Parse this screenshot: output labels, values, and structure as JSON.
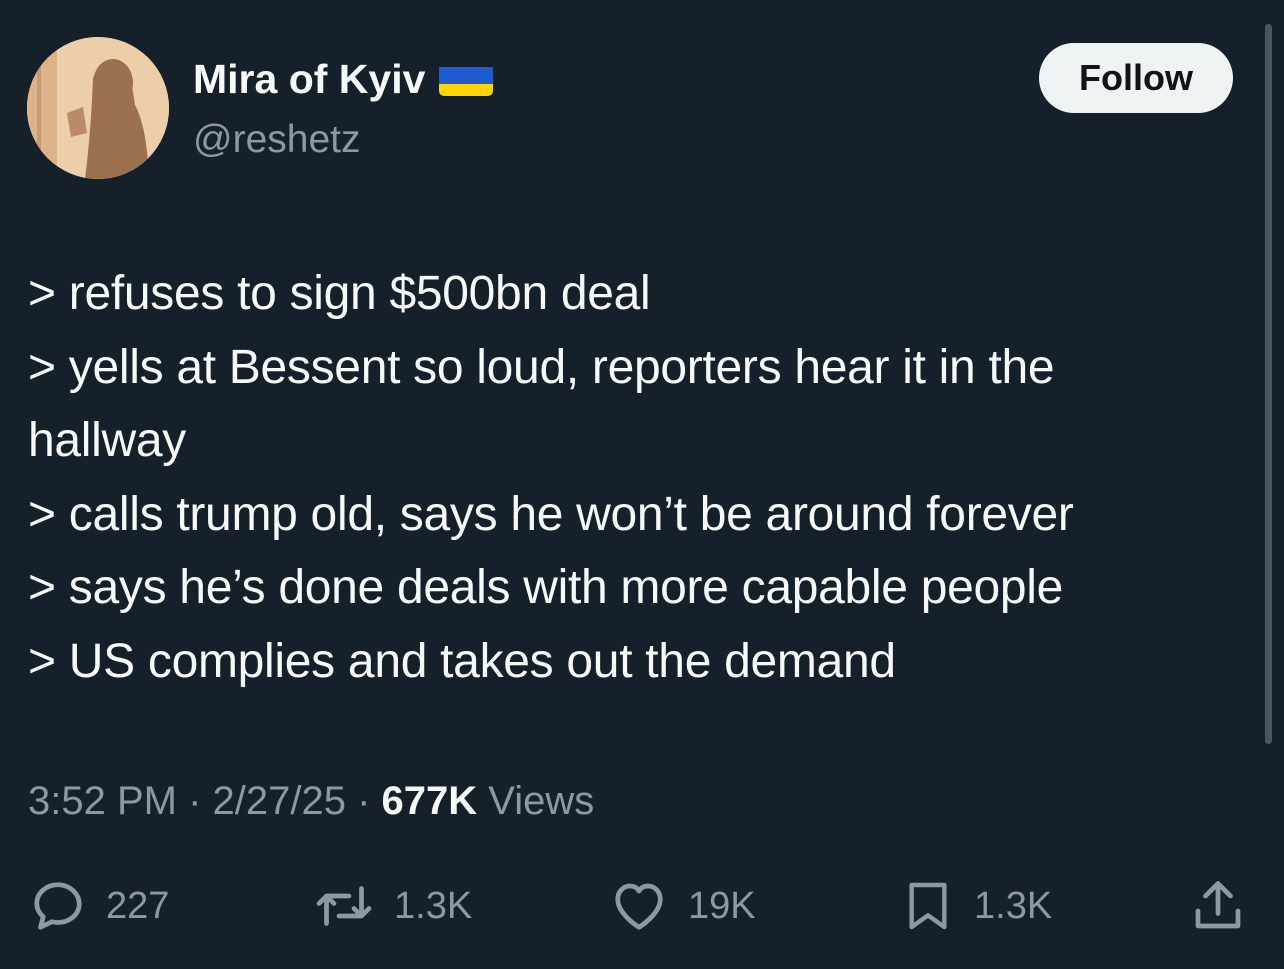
{
  "author": {
    "display_name": "Mira of Kyiv",
    "handle": "@reshetz",
    "flag_icon": "ukraine-flag-icon"
  },
  "follow_label": "Follow",
  "tweet": {
    "lines": [
      "> refuses to sign $500bn deal",
      "> yells at Bessent so loud, reporters hear it in the",
      "hallway",
      "> calls trump old, says he won’t be around forever",
      "> says he’s done deals with more capable people",
      "> US complies and takes out the demand"
    ]
  },
  "meta": {
    "time": "3:52 PM",
    "separator": " · ",
    "date": "2/27/25",
    "views_count": "677K",
    "views_label": " Views"
  },
  "actions": {
    "replies": "227",
    "reposts": "1.3K",
    "likes": "19K",
    "bookmarks": "1.3K"
  },
  "colors": {
    "background": "#15202b",
    "text": "#f7f9f9",
    "secondary": "#8b98a5",
    "button_bg": "#eff3f4",
    "flag_blue": "#1f5bd0",
    "flag_yellow": "#ffd500"
  }
}
